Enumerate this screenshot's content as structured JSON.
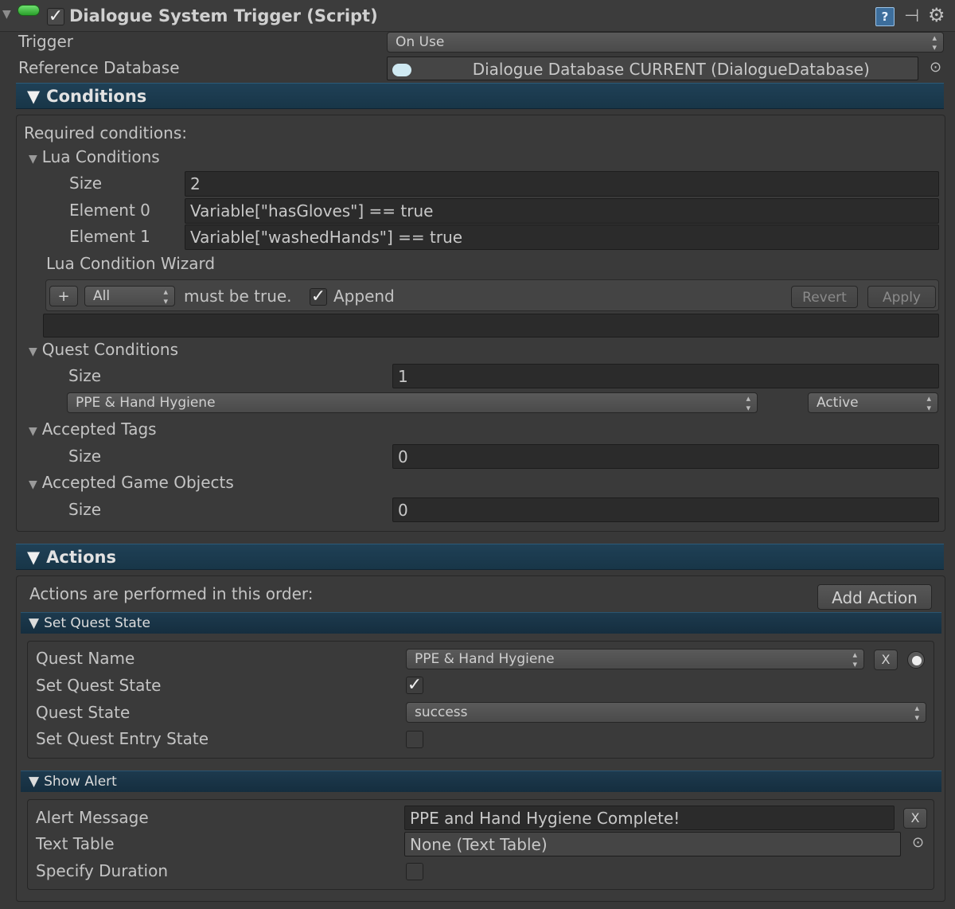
{
  "header": {
    "title": "Dialogue System Trigger (Script)",
    "trigger_label": "Trigger",
    "trigger_value": "On Use",
    "refdb_label": "Reference Database",
    "refdb_value": "Dialogue Database CURRENT (DialogueDatabase)"
  },
  "conditions": {
    "title": "Conditions",
    "required": "Required conditions:",
    "lua": {
      "title": "Lua Conditions",
      "size_label": "Size",
      "size_value": "2",
      "elements": [
        {
          "label": "Element 0",
          "value": "Variable[\"hasGloves\"] == true"
        },
        {
          "label": "Element 1",
          "value": "Variable[\"washedHands\"] == true"
        }
      ]
    },
    "wizard": {
      "title": "Lua Condition Wizard",
      "plus": "+",
      "mode": "All",
      "must_be_true": "must be true.",
      "append": "Append",
      "revert": "Revert",
      "apply": "Apply"
    },
    "quest": {
      "title": "Quest Conditions",
      "size_label": "Size",
      "size_value": "1",
      "quest_name": "PPE & Hand Hygiene",
      "quest_state": "Active"
    },
    "tags": {
      "title": "Accepted Tags",
      "size_label": "Size",
      "size_value": "0"
    },
    "gameobjects": {
      "title": "Accepted Game Objects",
      "size_label": "Size",
      "size_value": "0"
    }
  },
  "actions": {
    "title": "Actions",
    "order_text": "Actions are performed in this order:",
    "add_action": "Add Action",
    "set_quest_state": {
      "title": "Set Quest State",
      "quest_name_label": "Quest Name",
      "quest_name_value": "PPE & Hand Hygiene",
      "x": "X",
      "set_state_label": "Set Quest State",
      "quest_state_label": "Quest State",
      "quest_state_value": "success",
      "set_entry_label": "Set Quest Entry State"
    },
    "show_alert": {
      "title": "Show Alert",
      "message_label": "Alert Message",
      "message_value": "PPE and Hand Hygiene Complete!",
      "x": "X",
      "table_label": "Text Table",
      "table_value": "None (Text Table)",
      "duration_label": "Specify Duration"
    }
  }
}
